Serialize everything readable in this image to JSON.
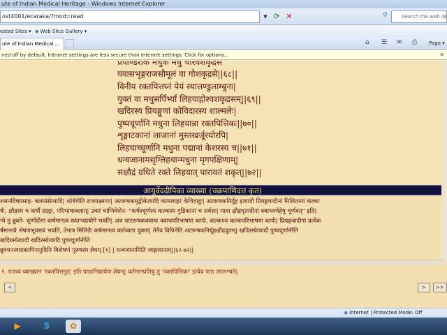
{
  "window": {
    "title": "ute of Indian Medical Heritage - Windows Internet Explorer"
  },
  "address": {
    "url": "ost4001/ecaraka/?mod=read"
  },
  "search": {
    "placeholder": "Search the web (Ba"
  },
  "favorites": {
    "suggested": "ested Sites ▾",
    "webslice": "Web Slice Gallery ▾"
  },
  "tab": {
    "title": "ute of Indian Medical ..."
  },
  "toolbar": {
    "page_label": "Page ▾"
  },
  "infobar": {
    "message": "ned off by default. Intranet settings are less secure than Internet settings. Click for options..."
  },
  "verses": [
    "प्रपाण्डरीकं मधुकं मधु चारवशकृद्रसे",
    "यवासभृङ्गराजसौमूलं वा गोशकृद्रसे||६८||",
    "विनीय रक्तपित्तघ्नं पेयं स्यात्तण्डुलाम्बुना|",
    "युक्तं वा मधुसर्पिर्भ्यां लिहयाद्गोश्वशकृद्रसम्||६९||",
    "खदिरस्य प्रियङ्गूणां कोविदारस्य शाल्मलेः|",
    "पुष्पचूर्णानि मधुना लिहयान्ना रक्तपित्तिकः||७०||",
    "शृङ्गाटकानां लाजानां मुस्तखर्जूरयोरपि|",
    "लिहयाच्चूर्णानि मधुना पद्मानां केशरस्य च||७१||",
    "धन्वजानामसृग्लिहयान्मधुना मृगपक्षिणाम्|",
    "सक्षौद्रं ग्रथिते रक्ते लिहयात् पारावतं शकृत्||७२||"
  ],
  "commentary": {
    "title": "आयुर्वेददीपिका व्याख्या (चक्रपाणिदत्त कृत)",
    "lines": [
      "शमनविषयमाह- बलमांसेत्यादि| शोषेणेति राजयक्ष्मणा| अटरूषकमृद्वीकेत्यादि कामलाहरं केचिदाहुः| अटरूषकनिर्यूह इत्यादौ प्रियङ्गवादीनां मिलितानां कल्कः",
      "र्षः, क्षौद्रस्य च कर्षौ ग्राह्यः, परिभाषाबलात्| उक्तं चाग्निवेशेन- \"कर्षश्चूर्णस्य कल्कस्य गुडिकानां च सर्वशः| मात्रा क्षौद्रघृतादीनां क्वाथश्चेहेषु चूर्णवत्\" इति|",
      "न्ये तु ब्रुवते- चूर्णादीनां कर्षमानत्वं स्वतन्त्रप्रयोगे भवति| अत्र चाटरूषकक्वाथः क्वाथपरिभाषया कार्यः, कल्कश्च कल्कपरिभाषया कार्यः| प्रियङ्गवादीनां प्रत्येक",
      "र्षमानत्वे भेषजभूयस्त्वं भवति, तेनात्र मिलितैः कर्षमानत्वं कर्तव्यता युक्ता| तेनैव विपिनेति अटरूषकनिर्यूहक्षौद्रयुतम्| खदिरस्येत्यादौ पुष्पचूर्णानीति",
      "खदिरस्येत्यादौ खदिरस्येत्यादि पुष्पचूर्णानीति",
      "व्रुवचनत्वादक्तपित्तनुदिति विशेषणं पुरुषस्य ज्ञेयम् [१] | धन्वजानामिति जाङ्गलानाम्||६२-७२||"
    ],
    "footnote_mark": "[१]"
  },
  "variant_note": "१. एतच्च व्याख्यानं 'रक्तपित्तनुत्' इति पाठाभिप्रायेण ज्ञेयम्| वर्तमानप्रतिषु तु 'रक्तपित्तिकः' इत्येव पाठ उपलभ्यते|",
  "pager": {
    "back": "<",
    "next": ">",
    "last": ">>"
  },
  "status": {
    "zone": "Internet | Protected Mode: Off"
  }
}
